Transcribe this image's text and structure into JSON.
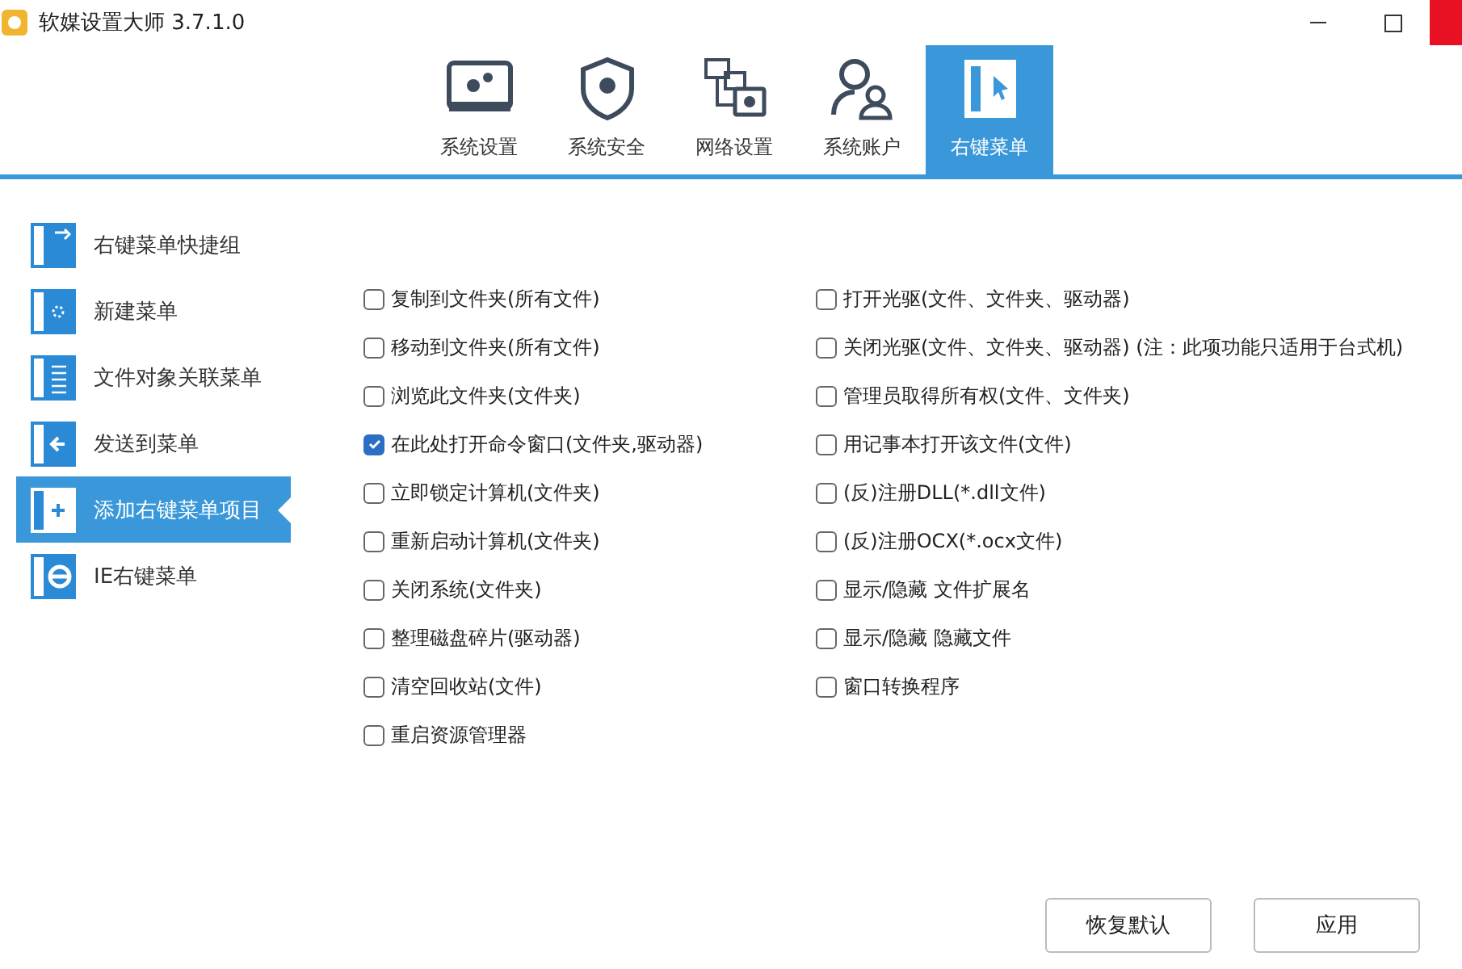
{
  "window": {
    "title": "软媒设置大师 3.7.1.0"
  },
  "tabs": [
    {
      "label": "系统设置",
      "selected": false
    },
    {
      "label": "系统安全",
      "selected": false
    },
    {
      "label": "网络设置",
      "selected": false
    },
    {
      "label": "系统账户",
      "selected": false
    },
    {
      "label": "右键菜单",
      "selected": true
    }
  ],
  "sidebar": {
    "items": [
      {
        "label": "右键菜单快捷组",
        "selected": false
      },
      {
        "label": "新建菜单",
        "selected": false
      },
      {
        "label": "文件对象关联菜单",
        "selected": false
      },
      {
        "label": "发送到菜单",
        "selected": false
      },
      {
        "label": "添加右键菜单项目",
        "selected": true
      },
      {
        "label": "IE右键菜单",
        "selected": false
      }
    ]
  },
  "options_left": [
    {
      "label": "复制到文件夹(所有文件)",
      "checked": false
    },
    {
      "label": "移动到文件夹(所有文件)",
      "checked": false
    },
    {
      "label": "浏览此文件夹(文件夹)",
      "checked": false
    },
    {
      "label": "在此处打开命令窗口(文件夹,驱动器)",
      "checked": true
    },
    {
      "label": "立即锁定计算机(文件夹)",
      "checked": false
    },
    {
      "label": "重新启动计算机(文件夹)",
      "checked": false
    },
    {
      "label": "关闭系统(文件夹)",
      "checked": false
    },
    {
      "label": "整理磁盘碎片(驱动器)",
      "checked": false
    },
    {
      "label": "清空回收站(文件)",
      "checked": false
    },
    {
      "label": "重启资源管理器",
      "checked": false
    }
  ],
  "options_right": [
    {
      "label": "打开光驱(文件、文件夹、驱动器)",
      "checked": false
    },
    {
      "label": "关闭光驱(文件、文件夹、驱动器) (注：此项功能只适用于台式机)",
      "checked": false
    },
    {
      "label": "管理员取得所有权(文件、文件夹)",
      "checked": false
    },
    {
      "label": "用记事本打开该文件(文件)",
      "checked": false
    },
    {
      "label": "(反)注册DLL(*.dll文件)",
      "checked": false
    },
    {
      "label": "(反)注册OCX(*.ocx文件)",
      "checked": false
    },
    {
      "label": "显示/隐藏 文件扩展名",
      "checked": false
    },
    {
      "label": "显示/隐藏 隐藏文件",
      "checked": false
    },
    {
      "label": "窗口转换程序",
      "checked": false
    }
  ],
  "buttons": [
    "恢复默认",
    "应用"
  ]
}
